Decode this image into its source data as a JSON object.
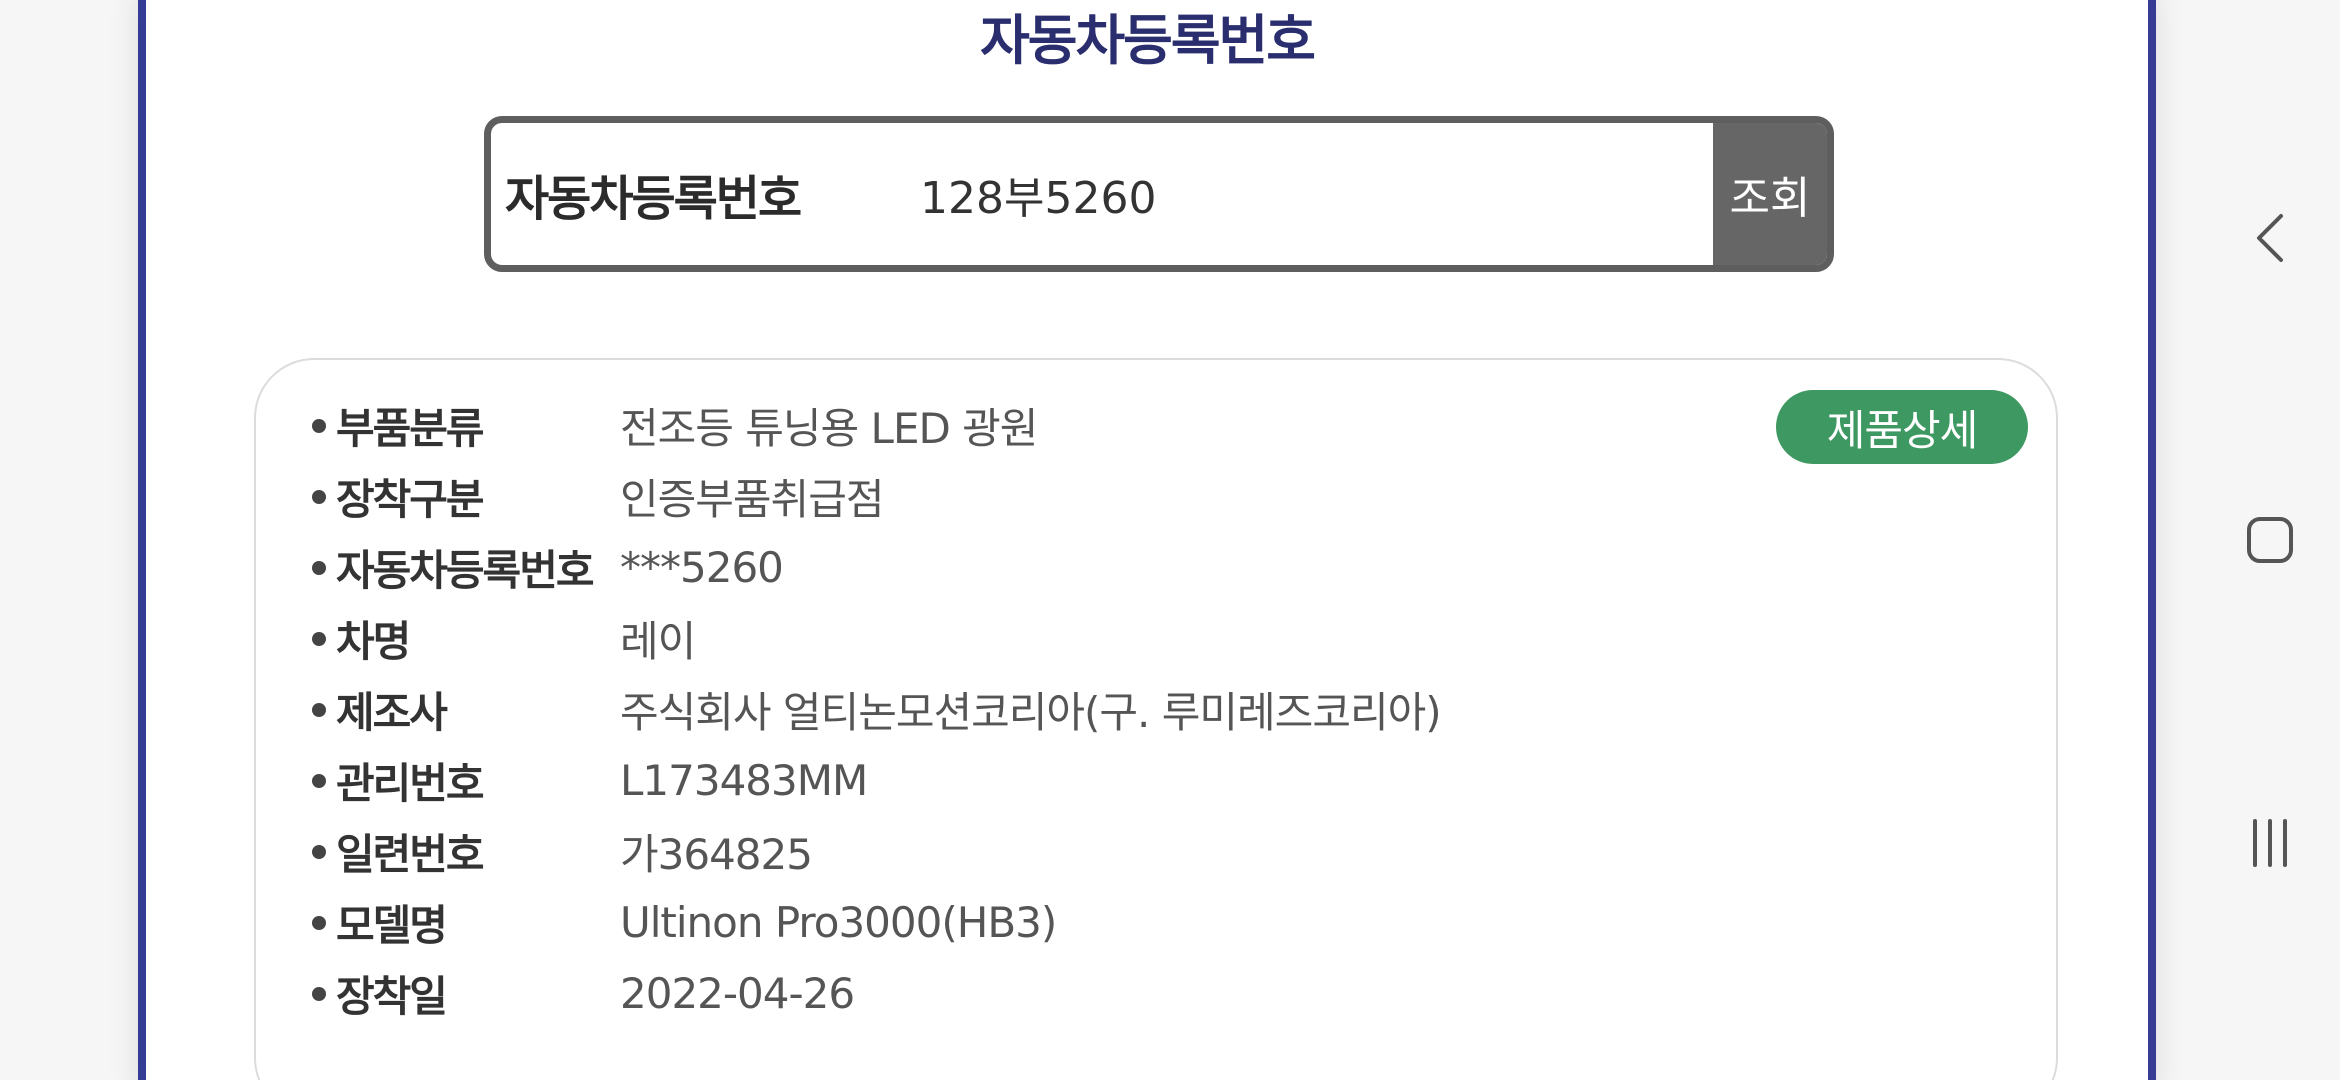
{
  "header": {
    "title": "자동차등록번호"
  },
  "search": {
    "label": "자동차등록번호",
    "value": "128부5260",
    "button_label": "조회"
  },
  "card": {
    "detail_button_label": "제품상세",
    "rows": [
      {
        "label": "부품분류",
        "value": "전조등 튜닝용 LED 광원"
      },
      {
        "label": "장착구분",
        "value": "인증부품취급점"
      },
      {
        "label": "자동차등록번호",
        "value": "***5260"
      },
      {
        "label": "차명",
        "value": "레이"
      },
      {
        "label": "제조사",
        "value": "주식회사 얼티논모션코리아(구. 루미레즈코리아)"
      },
      {
        "label": "관리번호",
        "value": "L173483MM"
      },
      {
        "label": "일련번호",
        "value": "가364825"
      },
      {
        "label": "모델명",
        "value": "Ultinon Pro3000(HB3)"
      },
      {
        "label": "장착일",
        "value": "2022-04-26"
      }
    ]
  },
  "nav": {
    "back_icon": "chevron-left-icon",
    "home_icon": "home-square-icon",
    "recents_icon": "recent-apps-icon"
  },
  "colors": {
    "frame_border": "#363b93",
    "title": "#2a2e6e",
    "detail_button": "#3d9862",
    "search_button": "#666666"
  }
}
